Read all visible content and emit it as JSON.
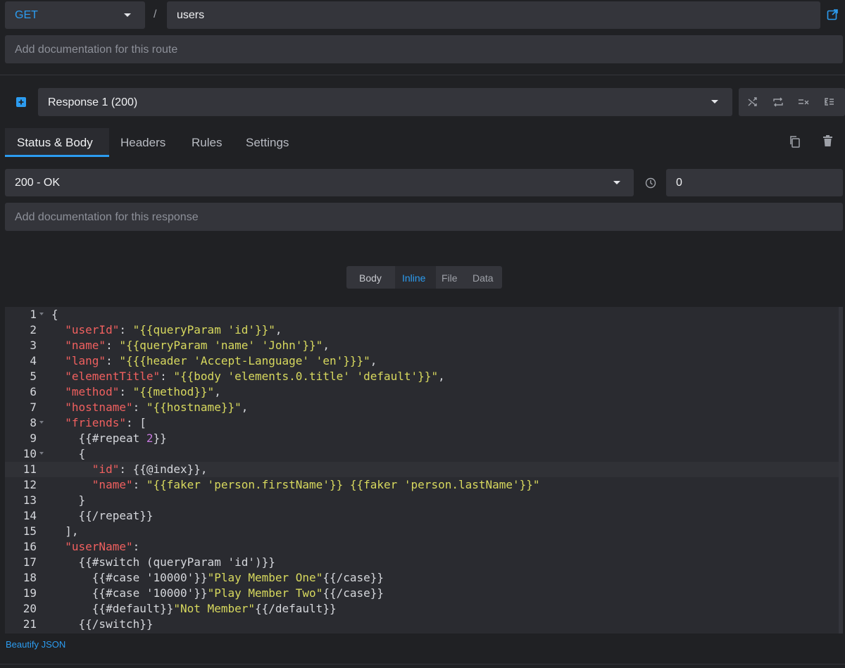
{
  "route": {
    "method": "GET",
    "separator": "/",
    "path": "users",
    "doc_placeholder": "Add documentation for this route"
  },
  "response": {
    "selected": "Response 1 (200)",
    "tabs": [
      "Status & Body",
      "Headers",
      "Rules",
      "Settings"
    ],
    "active_tab": "Status & Body",
    "status": "200 - OK",
    "latency": "0",
    "doc_placeholder": "Add documentation for this response"
  },
  "body_type": {
    "label": "Body",
    "options": [
      "Inline",
      "File",
      "Data"
    ],
    "selected": "Inline"
  },
  "editor": {
    "current_line": 11,
    "lines": [
      {
        "n": "1",
        "fold": true,
        "indent": 0,
        "tokens": [
          [
            "p",
            "{"
          ]
        ]
      },
      {
        "n": "2",
        "fold": false,
        "indent": 1,
        "tokens": [
          [
            "k",
            "\"userId\""
          ],
          [
            "p",
            ": "
          ],
          [
            "s",
            "\"{{queryParam 'id'}}\""
          ],
          [
            "p",
            ","
          ]
        ]
      },
      {
        "n": "3",
        "fold": false,
        "indent": 1,
        "tokens": [
          [
            "k",
            "\"name\""
          ],
          [
            "p",
            ": "
          ],
          [
            "s",
            "\"{{queryParam 'name' 'John'}}\""
          ],
          [
            "p",
            ","
          ]
        ]
      },
      {
        "n": "4",
        "fold": false,
        "indent": 1,
        "tokens": [
          [
            "k",
            "\"lang\""
          ],
          [
            "p",
            ": "
          ],
          [
            "s",
            "\"{{{header 'Accept-Language' 'en'}}}\""
          ],
          [
            "p",
            ","
          ]
        ]
      },
      {
        "n": "5",
        "fold": false,
        "indent": 1,
        "tokens": [
          [
            "k",
            "\"elementTitle\""
          ],
          [
            "p",
            ": "
          ],
          [
            "s",
            "\"{{body 'elements.0.title' 'default'}}\""
          ],
          [
            "p",
            ","
          ]
        ]
      },
      {
        "n": "6",
        "fold": false,
        "indent": 1,
        "tokens": [
          [
            "k",
            "\"method\""
          ],
          [
            "p",
            ": "
          ],
          [
            "s",
            "\"{{method}}\""
          ],
          [
            "p",
            ","
          ]
        ]
      },
      {
        "n": "7",
        "fold": false,
        "indent": 1,
        "tokens": [
          [
            "k",
            "\"hostname\""
          ],
          [
            "p",
            ": "
          ],
          [
            "s",
            "\"{{hostname}}\""
          ],
          [
            "p",
            ","
          ]
        ]
      },
      {
        "n": "8",
        "fold": true,
        "indent": 1,
        "tokens": [
          [
            "k",
            "\"friends\""
          ],
          [
            "p",
            ": ["
          ]
        ]
      },
      {
        "n": "9",
        "fold": false,
        "indent": 2,
        "tokens": [
          [
            "p",
            "{{#repeat "
          ],
          [
            "n",
            "2"
          ],
          [
            "p",
            "}}"
          ]
        ]
      },
      {
        "n": "10",
        "fold": true,
        "indent": 2,
        "tokens": [
          [
            "p",
            "{"
          ]
        ]
      },
      {
        "n": "11",
        "fold": false,
        "indent": 3,
        "tokens": [
          [
            "k",
            "\"id\""
          ],
          [
            "p",
            ": {{@index}},"
          ]
        ]
      },
      {
        "n": "12",
        "fold": false,
        "indent": 3,
        "tokens": [
          [
            "k",
            "\"name\""
          ],
          [
            "p",
            ": "
          ],
          [
            "s",
            "\"{{faker 'person.firstName'}} {{faker 'person.lastName'}}\""
          ]
        ]
      },
      {
        "n": "13",
        "fold": false,
        "indent": 2,
        "tokens": [
          [
            "p",
            "}"
          ]
        ]
      },
      {
        "n": "14",
        "fold": false,
        "indent": 2,
        "tokens": [
          [
            "p",
            "{{/repeat}}"
          ]
        ]
      },
      {
        "n": "15",
        "fold": false,
        "indent": 1,
        "tokens": [
          [
            "p",
            "],"
          ]
        ]
      },
      {
        "n": "16",
        "fold": false,
        "indent": 1,
        "tokens": [
          [
            "k",
            "\"userName\""
          ],
          [
            "p",
            ":"
          ]
        ]
      },
      {
        "n": "17",
        "fold": false,
        "indent": 2,
        "tokens": [
          [
            "p",
            "{{#switch (queryParam 'id')}}"
          ]
        ]
      },
      {
        "n": "18",
        "fold": false,
        "indent": 3,
        "tokens": [
          [
            "p",
            "{{#case '10000'}}"
          ],
          [
            "s",
            "\"Play Member One\""
          ],
          [
            "p",
            "{{/case}}"
          ]
        ]
      },
      {
        "n": "19",
        "fold": false,
        "indent": 3,
        "tokens": [
          [
            "p",
            "{{#case '10000'}}"
          ],
          [
            "s",
            "\"Play Member Two\""
          ],
          [
            "p",
            "{{/case}}"
          ]
        ]
      },
      {
        "n": "20",
        "fold": false,
        "indent": 3,
        "tokens": [
          [
            "p",
            "{{#default}}"
          ],
          [
            "s",
            "\"Not Member\""
          ],
          [
            "p",
            "{{/default}}"
          ]
        ]
      },
      {
        "n": "21",
        "fold": false,
        "indent": 2,
        "tokens": [
          [
            "p",
            "{{/switch}}"
          ]
        ]
      }
    ]
  },
  "footer": {
    "beautify_label": "Beautify JSON"
  },
  "icons": {
    "open_external": "external-link-icon",
    "add_response": "plus-square-icon",
    "random": "shuffle-icon",
    "sequential": "repeat-icon",
    "disable_rules": "equals-x-icon",
    "fallback": "fallback-icon",
    "duplicate": "copy-icon",
    "delete": "trash-icon",
    "latency": "clock-icon"
  },
  "colors": {
    "accent": "#2c9cf0",
    "background": "#202124",
    "field": "#34353b",
    "json_key": "#f0605f",
    "json_string": "#d8d95e",
    "json_number": "#c679dd"
  }
}
